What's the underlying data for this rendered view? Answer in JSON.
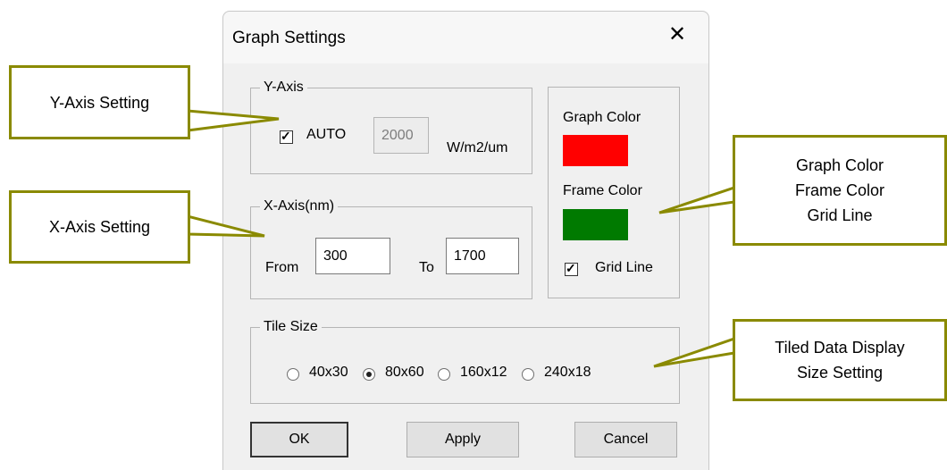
{
  "dialog": {
    "title": "Graph Settings",
    "close_glyph": "✕",
    "y_axis": {
      "legend": "Y-Axis",
      "auto_label": "AUTO",
      "auto_checked": true,
      "value": "2000",
      "unit": "W/m2/um"
    },
    "x_axis": {
      "legend": "X-Axis(nm)",
      "from_label": "From",
      "from_value": "300",
      "to_label": "To",
      "to_value": "1700"
    },
    "colors": {
      "graph_color_label": "Graph Color",
      "graph_color": "#ff0000",
      "frame_color_label": "Frame Color",
      "frame_color": "#007a00",
      "grid_line_label": "Grid Line",
      "grid_line_checked": true
    },
    "tile_size": {
      "legend": "Tile Size",
      "options": [
        "40x30",
        "80x60",
        "160x12",
        "240x18"
      ],
      "selected": "80x60"
    },
    "buttons": {
      "ok": "OK",
      "apply": "Apply",
      "cancel": "Cancel"
    }
  },
  "callouts": {
    "y_axis": "Y-Axis Setting",
    "x_axis": "X-Axis Setting",
    "color": [
      "Graph Color",
      "Frame Color",
      "Grid Line"
    ],
    "tile": [
      "Tiled Data Display",
      "Size Setting"
    ]
  },
  "accent_colors": {
    "callout_border": "#8a8a00"
  }
}
